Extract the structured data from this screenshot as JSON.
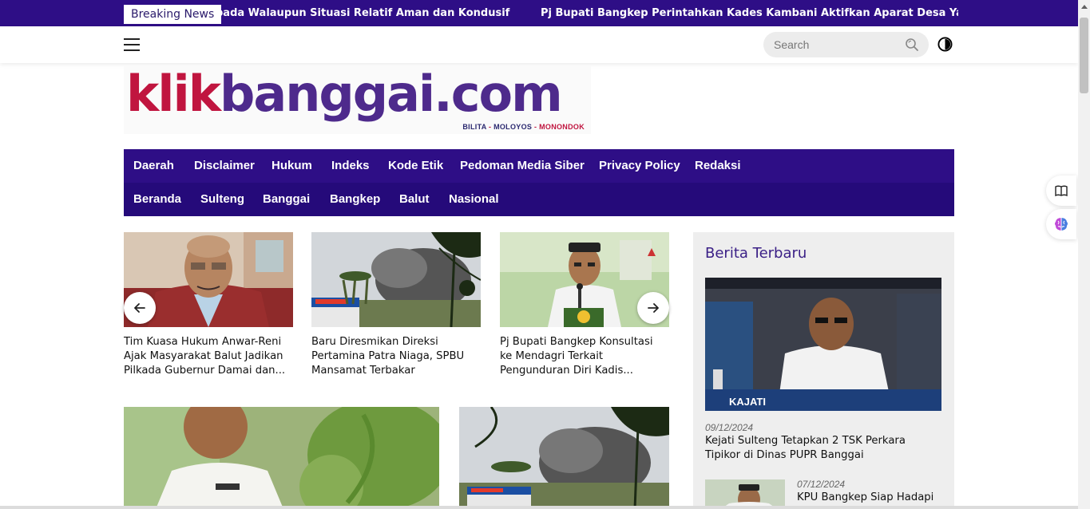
{
  "ticker": {
    "label": "Breaking News",
    "items": [
      "Kapolda Sulteng Tegaskan Netralitas Polri pada Walaupun Situasi Relatif Aman dan Kondusif",
      "Pj Bupati Bangkep Perintahkan Kades Kambani Aktifkan Aparat Desa Yang Di"
    ],
    "visible": [
      "pada Walaupun Situasi Relatif Aman dan Kondusif",
      "Pj Bupati Bangkep Perintahkan Kades Kambani Aktifkan Aparat Desa Yang Di"
    ]
  },
  "header": {
    "search_placeholder": "Search",
    "icons": [
      "menu-icon",
      "search-icon",
      "contrast-icon"
    ]
  },
  "logo": {
    "part1": "klik",
    "part2": "banggai.com",
    "tagline": [
      "BILITA",
      "MOLOYOS",
      "MONONDOK"
    ],
    "tagline_separator": " - "
  },
  "nav_primary": [
    "Daerah",
    "Disclaimer",
    "Hukum",
    "Indeks",
    "Kode Etik",
    "Pedoman Media Siber",
    "Privacy Policy",
    "Redaksi"
  ],
  "nav_secondary": [
    "Beranda",
    "Sulteng",
    "Banggai",
    "Bangkep",
    "Balut",
    "Nasional"
  ],
  "carousel": {
    "items": [
      {
        "line1": "Tim Kuasa Hukum Anwar-Reni",
        "line2": "Ajak Masyarakat Balut Jadikan",
        "line3": "Pilkada Gubernur Damai dan..."
      },
      {
        "line1": "Baru Diresmikan Direksi",
        "line2": "Pertamina Patra Niaga, SPBU",
        "line3": "Mansamat Terbakar"
      },
      {
        "line1": "Pj Bupati Bangkep Konsultasi",
        "line2": "ke Mendagri Terkait",
        "line3": "Pengunduran Diri Kadis..."
      }
    ]
  },
  "sidebar": {
    "title": "Berita Terbaru",
    "featured": {
      "date": "09/12/2024",
      "line1": "Kejati Sulteng Tetapkan 2 TSK Perkara",
      "line2": "Tipikor di Dinas PUPR Banggai",
      "image_text": "KAJATI"
    },
    "second": {
      "date": "07/12/2024",
      "headline": "KPU Bangkep Siap Hadapi"
    }
  },
  "colors": {
    "brand_purple": "#2e0e86",
    "brand_red": "#c0153f",
    "logo_purple": "#4e2a8c"
  }
}
